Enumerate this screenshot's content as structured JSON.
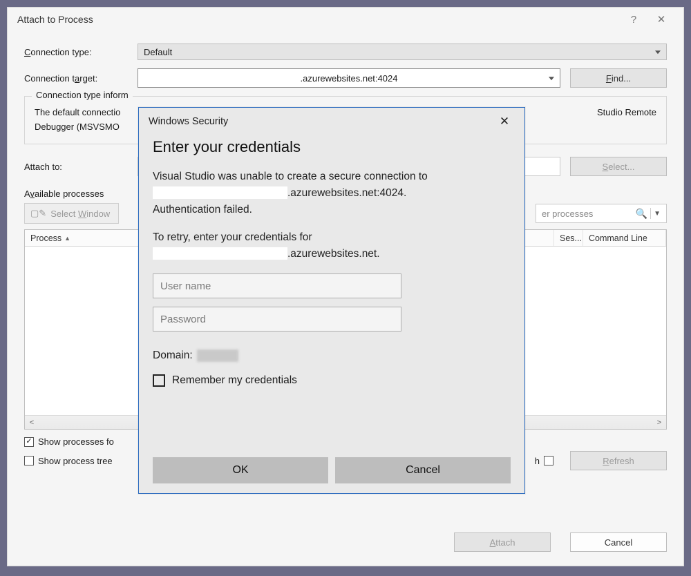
{
  "window": {
    "title": "Attach to Process",
    "help": "?",
    "close": "✕"
  },
  "connection_type": {
    "label": "Connection type:",
    "label_u": "C",
    "value": "Default"
  },
  "connection_target": {
    "label": "Connection target:",
    "label_u": "a",
    "value": ".azurewebsites.net:4024",
    "find": "Find...",
    "find_u": "F"
  },
  "group": {
    "legend": "Connection type inform",
    "line1": "The default connectio",
    "line2": "Debugger (MSVSMO",
    "tail": "Studio Remote"
  },
  "attach_to": {
    "label": "Attach to:",
    "select": "Select...",
    "select_u": "S"
  },
  "available": {
    "label": "Available processes",
    "select_window": "Select Window",
    "select_window_u": "W",
    "filter_placeholder": "er processes",
    "columns": {
      "process": "Process",
      "ses": "Ses...",
      "cmd": "Command Line"
    }
  },
  "checks": {
    "show_all": "Show processes fo",
    "show_tree": "Show process tree",
    "auto_tail": "h",
    "refresh": "Refresh",
    "refresh_u": "R"
  },
  "footer": {
    "attach": "Attach",
    "attach_u": "A",
    "cancel": "Cancel"
  },
  "modal": {
    "title": "Windows Security",
    "heading": "Enter your credentials",
    "msg1_a": "Visual Studio was unable to create a secure connection to",
    "msg1_b": ".azurewebsites.net:4024.",
    "msg1_c": "Authentication failed.",
    "msg2_a": "To retry, enter your credentials for",
    "msg2_b": ".azurewebsites.net.",
    "user_ph": "User name",
    "pass_ph": "Password",
    "domain_label": "Domain:",
    "remember": "Remember my credentials",
    "ok": "OK",
    "cancel": "Cancel"
  }
}
